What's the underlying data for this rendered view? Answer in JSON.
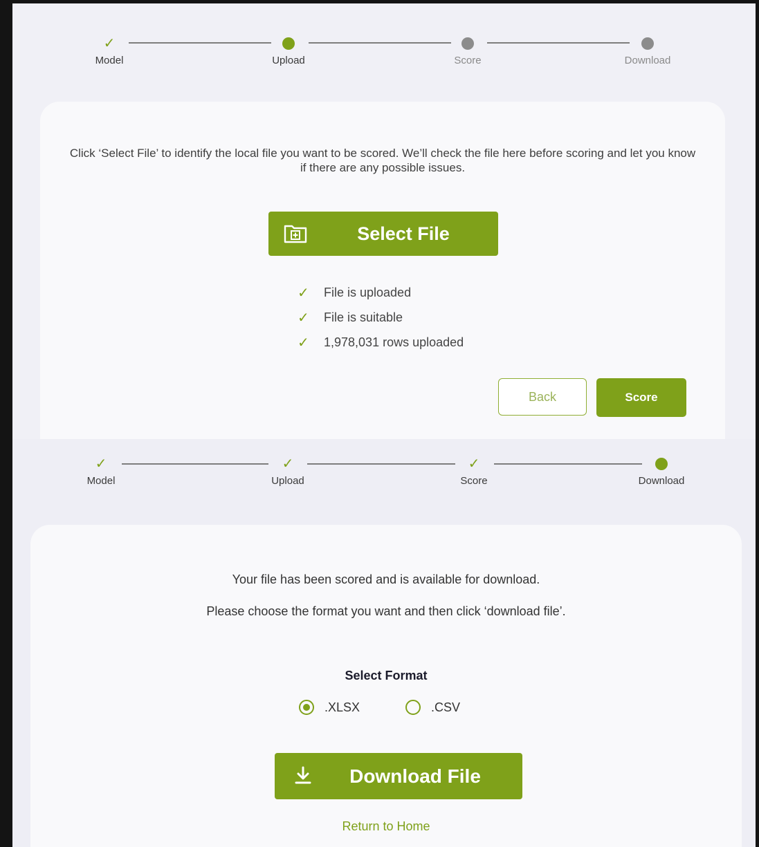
{
  "colors": {
    "accent": "#7fa11a",
    "inactive_dot": "#8c8c8c",
    "panel_bg": "#f0f0f6",
    "card_bg": "#f9f9fb"
  },
  "upload_view": {
    "steps": [
      {
        "label": "Model",
        "state": "done"
      },
      {
        "label": "Upload",
        "state": "current"
      },
      {
        "label": "Score",
        "state": "pending"
      },
      {
        "label": "Download",
        "state": "pending"
      }
    ],
    "intro": "Click ‘Select File’ to identify the local file you want to be scored. We’ll check the file here before scoring and let you know if there are any possible issues.",
    "select_file_label": "Select File",
    "select_file_icon": "folder-add-icon",
    "checks": [
      "File is uploaded",
      "File is suitable",
      "1,978,031 rows uploaded"
    ],
    "back_label": "Back",
    "score_label": "Score"
  },
  "download_view": {
    "steps": [
      {
        "label": "Model",
        "state": "done"
      },
      {
        "label": "Upload",
        "state": "done"
      },
      {
        "label": "Score",
        "state": "done"
      },
      {
        "label": "Download",
        "state": "current"
      }
    ],
    "message1": "Your file has been scored and is available for download.",
    "message2": "Please choose the format you want and then click ‘download file’.",
    "select_format_label": "Select Format",
    "formats": [
      {
        "label": ".XLSX",
        "selected": true
      },
      {
        "label": ".CSV",
        "selected": false
      }
    ],
    "download_label": "Download File",
    "download_icon": "download-icon",
    "return_home_label": "Return to Home"
  }
}
